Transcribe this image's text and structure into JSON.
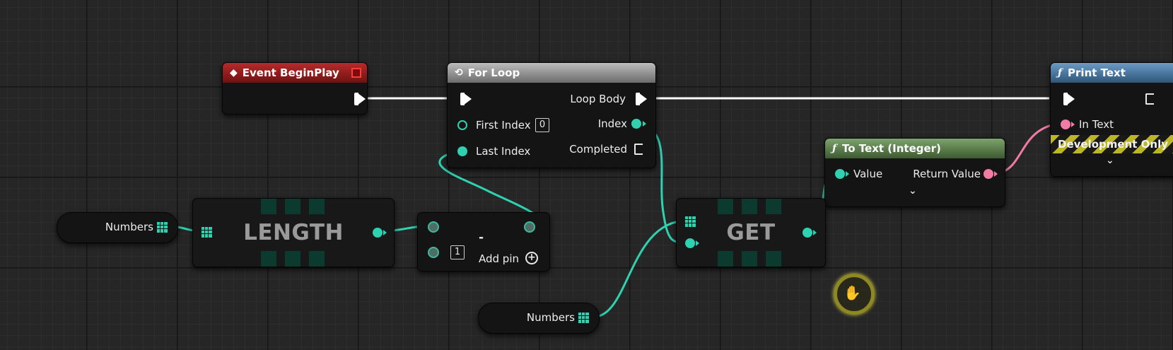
{
  "nodes": {
    "event_begin_play": {
      "title": "Event BeginPlay"
    },
    "for_loop": {
      "title": "For Loop",
      "loop_body": "Loop Body",
      "first_index": "First Index",
      "first_index_value": "0",
      "index": "Index",
      "last_index": "Last Index",
      "completed": "Completed"
    },
    "print_text": {
      "title": "Print Text",
      "in_text": "In Text",
      "development_only": "Development Only"
    },
    "to_text_integer": {
      "title": "To Text (Integer)",
      "value": "Value",
      "return_value": "Return Value"
    },
    "numbers_var_top": {
      "label": "Numbers"
    },
    "numbers_var_bottom": {
      "label": "Numbers"
    },
    "length": {
      "label": "LENGTH"
    },
    "subtract": {
      "operator": "-",
      "b_value": "1",
      "add_pin": "Add pin"
    },
    "get": {
      "label": "GET"
    }
  },
  "colors": {
    "exec_wire": "#ffffff",
    "integer_pin": "#2ed1b0",
    "text_pin": "#f07ba5",
    "event_header": "#9a1e1e",
    "macro_header": "#8a8a8a",
    "function_header_blue": "#4a7aa6",
    "function_header_green": "#5a7e4a",
    "grid_background": "#262626"
  },
  "icons": {
    "event": "diamond-event-icon",
    "macro": "loop-macro-icon",
    "function": "function-f-icon",
    "array": "array-grid-icon",
    "add": "plus-circle-icon",
    "expand": "chevron-down-icon"
  }
}
